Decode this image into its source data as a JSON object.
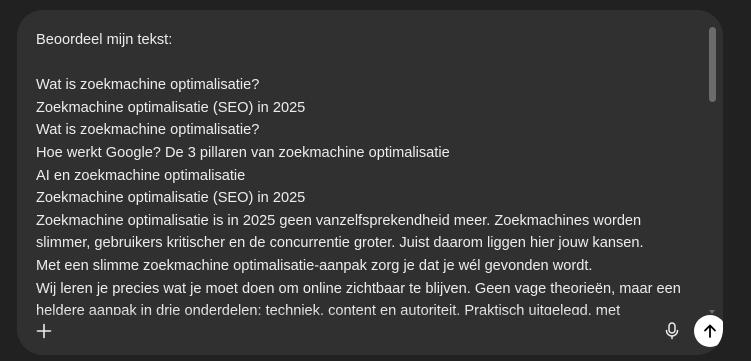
{
  "prompt": {
    "lines": [
      "Beoordeel mijn tekst:",
      "",
      "Wat is zoekmachine optimalisatie?",
      "Zoekmachine optimalisatie (SEO) in 2025",
      "Wat is zoekmachine optimalisatie?",
      "Hoe werkt Google? De 3 pillaren van zoekmachine optimalisatie",
      "AI en zoekmachine optimalisatie",
      "Zoekmachine optimalisatie (SEO) in 2025",
      "Zoekmachine optimalisatie is in 2025 geen vanzelfsprekendheid meer. Zoekmachines worden",
      "slimmer, gebruikers kritischer en de concurrentie groter. Juist daarom liggen hier jouw kansen.",
      "Met een slimme zoekmachine optimalisatie-aanpak zorg je dat je wél gevonden wordt.",
      "Wij leren je precies wat je moet doen om online zichtbaar te blijven. Geen vage theorieën, maar een",
      "heldere aanpak in drie onderdelen: techniek, content en autoriteit. Praktisch uitgelegd, met"
    ]
  },
  "toolbar": {
    "add_icon": "plus-icon",
    "mic_icon": "microphone-icon",
    "send_icon": "arrow-up-icon"
  },
  "colors": {
    "page_background": "#212121",
    "composer_background": "#303030",
    "text": "#ececec",
    "send_button": "#ffffff"
  }
}
